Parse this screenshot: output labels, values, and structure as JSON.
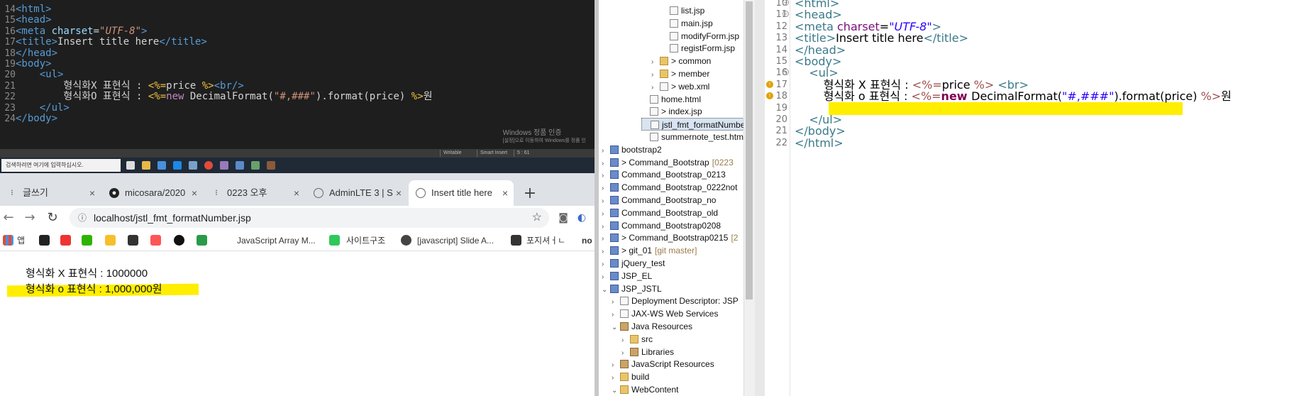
{
  "dark_editor": {
    "lines": [
      {
        "num": "14",
        "text": "<html>"
      },
      {
        "num": "15",
        "text": "<head>"
      },
      {
        "num": "16",
        "text": "<meta charset=\"UTF-8\">"
      },
      {
        "num": "17",
        "text": "<title>Insert title here</title>"
      },
      {
        "num": "18",
        "text": "</head>"
      },
      {
        "num": "19",
        "text": "<body>"
      },
      {
        "num": "20",
        "text": "    <ul>"
      },
      {
        "num": "21",
        "text": "        형식화X 표현식 : <%=price %><br/>"
      },
      {
        "num": "22",
        "text": "        형식화O 표현식 : <%=new DecimalFormat(\"#,###\").format(price) %>원"
      },
      {
        "num": "23",
        "text": "    </ul>"
      },
      {
        "num": "24",
        "text": "</body>"
      }
    ],
    "watermark": "Windows 정품 인증",
    "watermark2": "[설정]으로 이동하여 Windows를 정품 인",
    "status_writable": "Writable",
    "status_insert": "Smart Insert",
    "status_pos": "5 : 61"
  },
  "taskbar": {
    "search_placeholder": "검색하려면 여기에 입력하십시오."
  },
  "browser": {
    "tabs": [
      {
        "label": "글쓰기",
        "icon": "tistory-icon"
      },
      {
        "label": "micosara/2020",
        "icon": "github-icon"
      },
      {
        "label": "0223 오후",
        "icon": "tistory-icon"
      },
      {
        "label": "AdminLTE 3 | S",
        "icon": "globe-icon"
      },
      {
        "label": "Insert title here",
        "icon": "globe-icon",
        "active": true
      }
    ],
    "url": "localhost/jstl_fmt_formatNumber.jsp",
    "bookmarks": [
      {
        "label": "앱"
      },
      {
        "label": "JavaScript Array M..."
      },
      {
        "label": "사이트구조"
      },
      {
        "label": "[javascript] Slide A..."
      },
      {
        "label": "포지셔ㅓㄴ"
      },
      {
        "label": "no"
      }
    ]
  },
  "page_content": {
    "line1": "형식화 X 표현식 : 1000000",
    "line2": "형식화 o 표현식 : 1,000,000원"
  },
  "project_tree": {
    "items": [
      {
        "label": "list.jsp",
        "indent": 6,
        "kind": "file"
      },
      {
        "label": "main.jsp",
        "indent": 6,
        "kind": "file"
      },
      {
        "label": "modifyForm.jsp",
        "indent": 6,
        "kind": "file"
      },
      {
        "label": "registForm.jsp",
        "indent": 6,
        "kind": "file"
      },
      {
        "label": "> common",
        "indent": 5,
        "kind": "folder",
        "twisty": "›"
      },
      {
        "label": "> member",
        "indent": 5,
        "kind": "folder",
        "twisty": "›"
      },
      {
        "label": "> web.xml",
        "indent": 5,
        "kind": "file",
        "twisty": "›"
      },
      {
        "label": "home.html",
        "indent": 4,
        "kind": "file"
      },
      {
        "label": "> index.jsp",
        "indent": 4,
        "kind": "file"
      },
      {
        "label": "jstl_fmt_formatNumber.jsp",
        "indent": 4,
        "kind": "file",
        "selected": true
      },
      {
        "label": "summernote_test.html",
        "indent": 4,
        "kind": "file"
      },
      {
        "label": "bootstrap2",
        "indent": 0,
        "kind": "proj",
        "twisty": "›"
      },
      {
        "label": "> Command_Bootstrap",
        "suffix": "[0223",
        "indent": 0,
        "kind": "proj",
        "twisty": "›"
      },
      {
        "label": "Command_Bootstrap_0213",
        "indent": 0,
        "kind": "proj",
        "twisty": "›"
      },
      {
        "label": "Command_Bootstrap_0222not",
        "indent": 0,
        "kind": "proj",
        "twisty": "›"
      },
      {
        "label": "Command_Bootstrap_no",
        "indent": 0,
        "kind": "proj",
        "twisty": "›"
      },
      {
        "label": "Command_Bootstrap_old",
        "indent": 0,
        "kind": "proj",
        "twisty": "›"
      },
      {
        "label": "Command_Bootstrap0208",
        "indent": 0,
        "kind": "proj",
        "twisty": "›"
      },
      {
        "label": "> Command_Bootstrap0215",
        "suffix": "[2",
        "indent": 0,
        "kind": "proj",
        "twisty": "›"
      },
      {
        "label": "> git_01",
        "suffix": "[git master]",
        "indent": 0,
        "kind": "proj",
        "twisty": "›"
      },
      {
        "label": "jQuery_test",
        "indent": 0,
        "kind": "proj",
        "twisty": "›"
      },
      {
        "label": "JSP_EL",
        "indent": 0,
        "kind": "proj",
        "twisty": "›"
      },
      {
        "label": "JSP_JSTL",
        "indent": 0,
        "kind": "proj",
        "twisty": "⌄"
      },
      {
        "label": "Deployment Descriptor: JSP",
        "indent": 1,
        "kind": "file",
        "twisty": "›"
      },
      {
        "label": "JAX-WS Web Services",
        "indent": 1,
        "kind": "file",
        "twisty": "›"
      },
      {
        "label": "Java Resources",
        "indent": 1,
        "kind": "jar",
        "twisty": "⌄"
      },
      {
        "label": "src",
        "indent": 2,
        "kind": "folder",
        "twisty": "›"
      },
      {
        "label": "Libraries",
        "indent": 2,
        "kind": "jar",
        "twisty": "›"
      },
      {
        "label": "JavaScript Resources",
        "indent": 1,
        "kind": "jar",
        "twisty": "›"
      },
      {
        "label": "build",
        "indent": 1,
        "kind": "folder",
        "twisty": "›"
      },
      {
        "label": "WebContent",
        "indent": 1,
        "kind": "folder",
        "twisty": "⌄"
      }
    ]
  },
  "light_editor": {
    "lines": [
      {
        "num": "10",
        "text": "<html>"
      },
      {
        "num": "11",
        "text": "<head>"
      },
      {
        "num": "12",
        "text": "<meta charset=\"UTF-8\">"
      },
      {
        "num": "13",
        "text": "<title>Insert title here</title>"
      },
      {
        "num": "14",
        "text": "</head>"
      },
      {
        "num": "15",
        "text": "<body>"
      },
      {
        "num": "16",
        "text": "    <ul>"
      },
      {
        "num": "17",
        "text": "        형식화 X 표현식 : <%=price %> <br>"
      },
      {
        "num": "18",
        "text": "        형식화 o 표현식 : <%=new DecimalFormat(\"#,###\").format(price) %>원"
      },
      {
        "num": "19",
        "text": ""
      },
      {
        "num": "20",
        "text": "    </ul>"
      },
      {
        "num": "21",
        "text": "</body>"
      },
      {
        "num": "22",
        "text": "</html>"
      }
    ]
  },
  "colors": {
    "highlight": "#ffee00",
    "dark_bg": "#1e1e1e"
  }
}
